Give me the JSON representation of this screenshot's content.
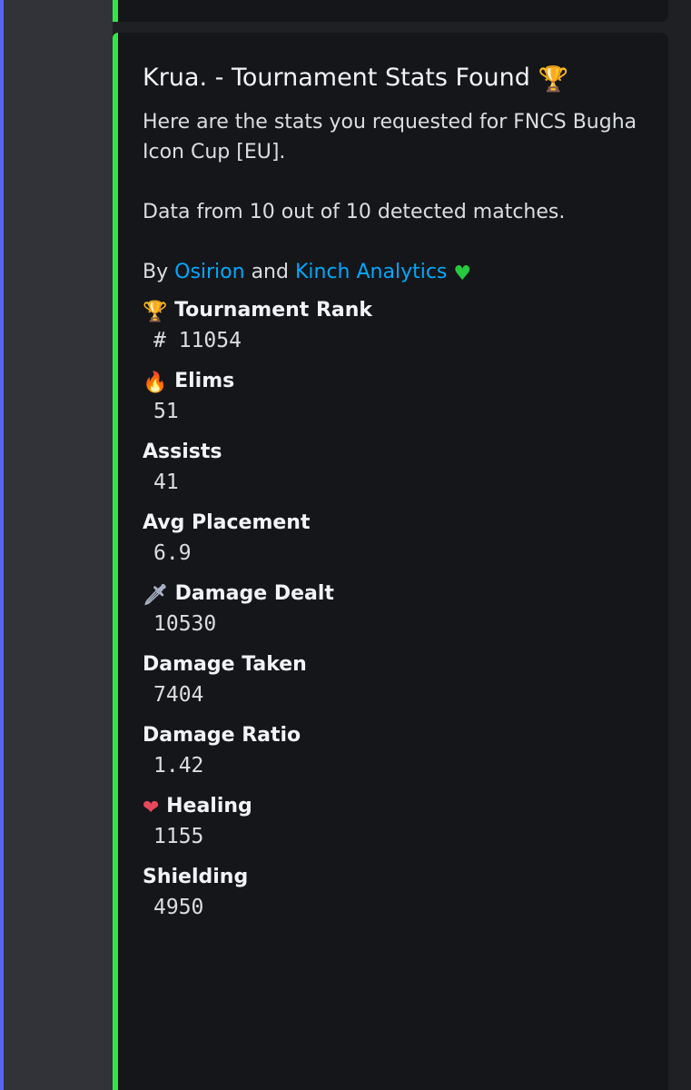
{
  "embed": {
    "title": "Krua. - Tournament Stats Found",
    "title_icon": "trophy",
    "description_line1": "Here are the stats you requested for FNCS Bugha Icon Cup  [EU].",
    "description_line2": "Data from 10 out of 10 detected matches.",
    "credit_prefix": "By",
    "credit_link1": "Osirion",
    "credit_and": "and",
    "credit_link2": "Kinch Analytics",
    "credit_icon": "green-heart",
    "accent_color": "#33e646",
    "link_color": "#00a8fc"
  },
  "fields": [
    {
      "icon": "trophy",
      "name": "Tournament Rank",
      "value": "# 11054"
    },
    {
      "icon": "fire",
      "name": "Elims",
      "value": "51"
    },
    {
      "icon": "",
      "name": "Assists",
      "value": "41"
    },
    {
      "icon": "",
      "name": "Avg Placement",
      "value": "6.9"
    },
    {
      "icon": "dagger",
      "name": "Damage Dealt",
      "value": "10530"
    },
    {
      "icon": "",
      "name": "Damage Taken",
      "value": "7404"
    },
    {
      "icon": "",
      "name": "Damage Ratio",
      "value": "1.42"
    },
    {
      "icon": "mending-heart",
      "name": "Healing",
      "value": "1155"
    },
    {
      "icon": "",
      "name": "Shielding",
      "value": "4950"
    }
  ]
}
